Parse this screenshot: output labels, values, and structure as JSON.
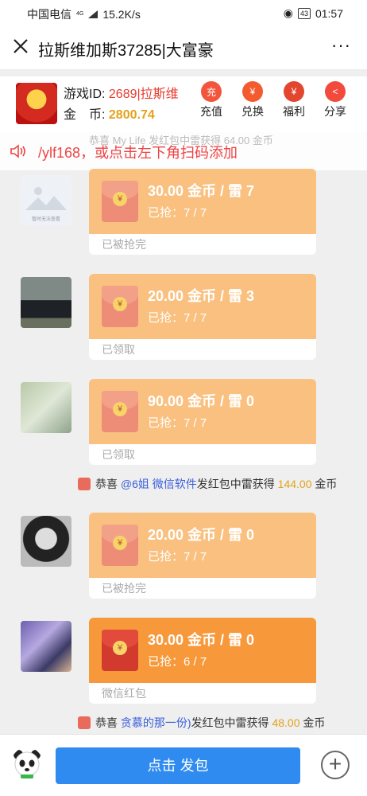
{
  "status_bar": {
    "carrier": "中国电信",
    "network": "4G",
    "speed": "15.2K/s",
    "battery": "43",
    "time": "01:57"
  },
  "header": {
    "title": "拉斯维加斯37285|大富豪",
    "more": "···"
  },
  "info": {
    "game_id_label": "游戏ID:",
    "game_id_value": "2689|拉斯维",
    "coin_label": "金　币:",
    "coin_value": "2800.74",
    "actions": [
      {
        "label": "充值",
        "icon": "recharge-icon",
        "glyph": "充",
        "color": "#f2553b"
      },
      {
        "label": "兑换",
        "icon": "exchange-icon",
        "glyph": "¥",
        "color": "#f35a2e"
      },
      {
        "label": "福利",
        "icon": "gift-bag-icon",
        "glyph": "¥",
        "color": "#e3462f"
      },
      {
        "label": "分享",
        "icon": "share-icon",
        "glyph": "<",
        "color": "#f24a3c"
      }
    ]
  },
  "marquee": {
    "faded_text": "恭喜 My Life 发红包中雷获得 64.00 金币",
    "text": "/ylf168，或点击左下角扫码添加"
  },
  "messages": [
    {
      "amount": "30.00 金币 / 雷 7",
      "grabbed": "已抢：7 / 7",
      "footer": "已被抢完"
    },
    {
      "amount": "20.00 金币 / 雷 3",
      "grabbed": "已抢：7 / 7",
      "footer": "已领取"
    },
    {
      "amount": "90.00 金币 / 雷 0",
      "grabbed": "已抢：7 / 7",
      "footer": "已领取"
    },
    {
      "amount": "20.00 金币 / 雷 0",
      "grabbed": "已抢：7 / 7",
      "footer": "已被抢完"
    },
    {
      "amount": "30.00 金币 / 雷 0",
      "grabbed": "已抢：6 / 7",
      "footer": "微信红包"
    }
  ],
  "notices": [
    {
      "prefix": "恭喜 ",
      "name": "@6姐 微信软件",
      "middle": "发红包中雷获得 ",
      "amount": "144.00",
      "suffix": " 金币"
    },
    {
      "prefix": "恭喜 ",
      "name": "贪慕的那一份)",
      "middle": "发红包中雷获得 ",
      "amount": "48.00",
      "suffix": " 金币"
    }
  ],
  "broken_image_text": "暂时无法查看",
  "bottom": {
    "send_label": "点击 发包",
    "plus": "+"
  }
}
